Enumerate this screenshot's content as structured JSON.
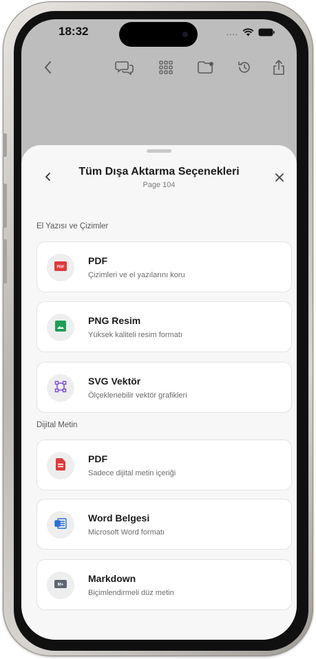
{
  "status_bar": {
    "time": "18:32",
    "signal_dots": "...."
  },
  "sheet": {
    "title": "Tüm Dışa Aktarma Seçenekleri",
    "subtitle": "Page 104"
  },
  "sections": {
    "handwriting": {
      "label": "El Yazısı ve Çizimler",
      "items": [
        {
          "title": "PDF",
          "desc": "Çizimleri ve el yazılarını koru",
          "icon": "pdf-icon",
          "icon_text": "PDF",
          "color": "#e03a3a"
        },
        {
          "title": "PNG Resim",
          "desc": "Yüksek kaliteli resim formatı",
          "icon": "image-icon",
          "color": "#1e9e5a"
        },
        {
          "title": "SVG Vektör",
          "desc": "Ölçeklenebilir vektör grafikleri",
          "icon": "vector-icon",
          "color": "#7a4fd8"
        }
      ]
    },
    "digital": {
      "label": "Dijital Metin",
      "items": [
        {
          "title": "PDF",
          "desc": "Sadece dijital metin içeriği",
          "icon": "document-icon",
          "color": "#e03a3a"
        },
        {
          "title": "Word Belgesi",
          "desc": "Microsoft Word formatı",
          "icon": "word-icon",
          "color": "#2b6fd6"
        },
        {
          "title": "Markdown",
          "desc": "Biçimlendirmeli düz metin",
          "icon": "markdown-icon",
          "icon_text": "M+",
          "color": "#5d6670"
        }
      ]
    }
  }
}
